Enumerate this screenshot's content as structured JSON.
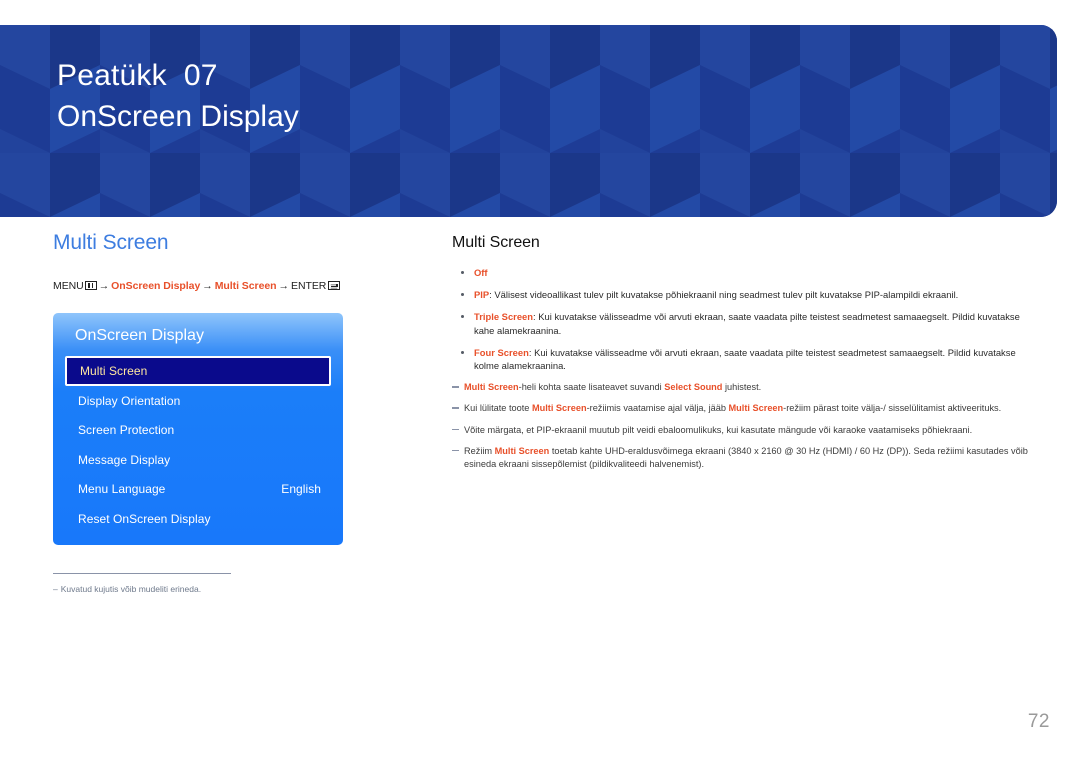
{
  "header": {
    "chapter_label": "Peatükk",
    "chapter_number": "07",
    "chapter_title": "OnScreen Display",
    "background_color": "#1e3c96"
  },
  "left": {
    "section_title": "Multi Screen",
    "path": {
      "menu_label": "MENU",
      "menu_icon": "menu-grid-icon",
      "arrow": "→",
      "step1": "OnScreen Display",
      "step2": "Multi Screen",
      "enter_label": "ENTER",
      "enter_icon": "enter-return-icon"
    },
    "osd": {
      "title": "OnScreen Display",
      "items": [
        {
          "label": "Multi Screen",
          "value": "",
          "selected": true
        },
        {
          "label": "Display Orientation",
          "value": "",
          "selected": false
        },
        {
          "label": "Screen Protection",
          "value": "",
          "selected": false
        },
        {
          "label": "Message Display",
          "value": "",
          "selected": false
        },
        {
          "label": "Menu Language",
          "value": "English",
          "selected": false
        },
        {
          "label": "Reset OnScreen Display",
          "value": "",
          "selected": false
        }
      ],
      "highlight_color": "#0a0a8c",
      "highlight_text_color": "#ffe8a0"
    },
    "footnote": {
      "dash": "–",
      "text": "Kuvatud kujutis võib mudeliti erineda."
    }
  },
  "right": {
    "title": "Multi Screen",
    "bullets": [
      {
        "term": "Off",
        "separator": "",
        "text": ""
      },
      {
        "term": "PIP",
        "separator": ": ",
        "text": "Välisest videoallikast tulev pilt kuvatakse põhiekraanil ning seadmest tulev pilt kuvatakse PIP-alampildi ekraanil."
      },
      {
        "term": "Triple Screen",
        "separator": ": ",
        "text": "Kui kuvatakse välisseadme või arvuti ekraan, saate vaadata pilte teistest seadmetest samaaegselt. Pildid kuvatakse kahe alamekraanina."
      },
      {
        "term": "Four Screen",
        "separator": ": ",
        "text": "Kui kuvatakse välisseadme või arvuti ekraan, saate vaadata pilte teistest seadmetest samaaegselt. Pildid kuvatakse kolme alamekraanina."
      }
    ],
    "notes": [
      {
        "parts": [
          {
            "t": "Multi Screen",
            "hl": true
          },
          {
            "t": "-heli kohta saate lisateavet suvandi ",
            "hl": false
          },
          {
            "t": "Select Sound",
            "hl": true
          },
          {
            "t": " juhistest.",
            "hl": false
          }
        ]
      },
      {
        "parts": [
          {
            "t": "Kui lülitate toote ",
            "hl": false
          },
          {
            "t": "Multi Screen",
            "hl": true
          },
          {
            "t": "-režiimis vaatamise ajal välja, jääb ",
            "hl": false
          },
          {
            "t": "Multi Screen",
            "hl": true
          },
          {
            "t": "-režiim pärast toite välja-/ sisselülitamist aktiveerituks.",
            "hl": false
          }
        ]
      },
      {
        "parts": [
          {
            "t": "Võite märgata, et PIP-ekraanil muutub pilt veidi ebaloomulikuks, kui kasutate mängude või karaoke vaatamiseks põhiekraani.",
            "hl": false
          }
        ]
      },
      {
        "parts": [
          {
            "t": "Režiim ",
            "hl": false
          },
          {
            "t": "Multi Screen",
            "hl": true
          },
          {
            "t": " toetab kahte UHD-eraldusvõimega ekraani (3840 x 2160 @ 30 Hz (HDMI) / 60 Hz (DP)). Seda režiimi kasutades võib esineda ekraani sissepõlemist (pildikvaliteedi halvenemist).",
            "hl": false
          }
        ]
      }
    ]
  },
  "page_number": "72",
  "colors": {
    "accent_orange": "#e8502a",
    "section_blue": "#3d7de0",
    "header_blue": "#1e3c96"
  }
}
